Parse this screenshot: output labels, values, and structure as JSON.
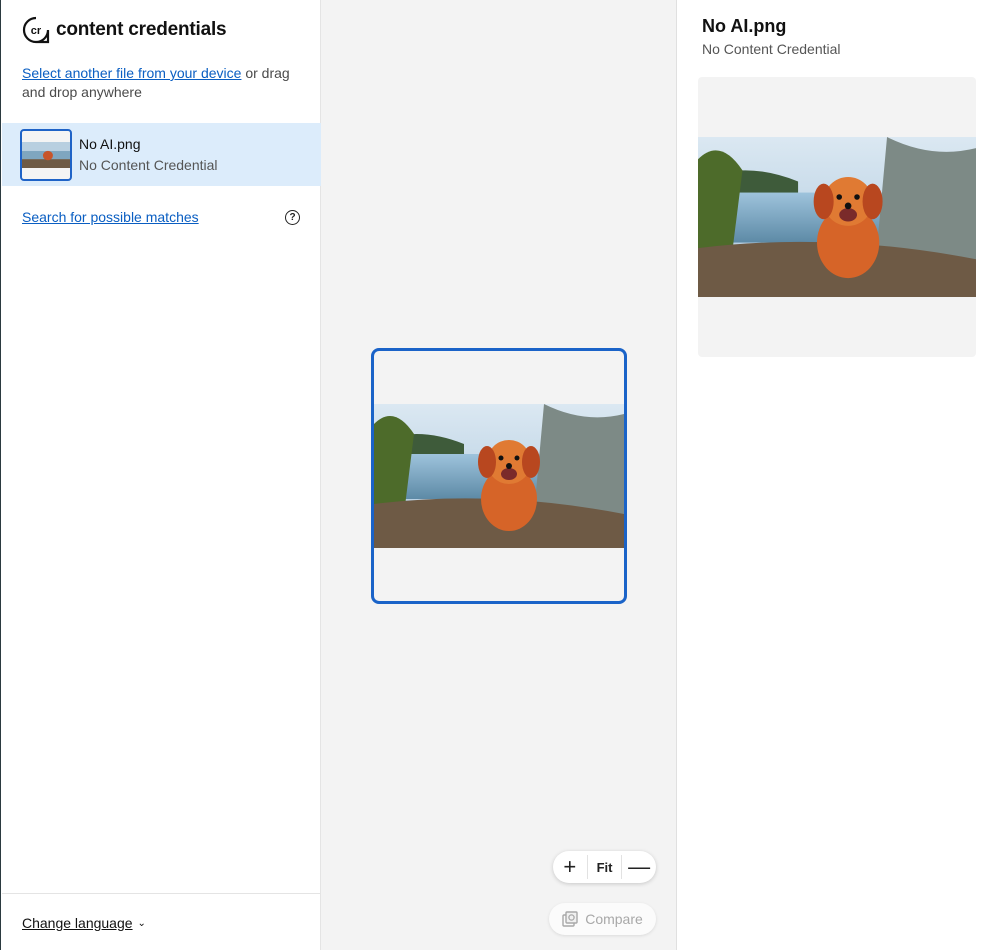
{
  "brand": {
    "name": "content credentials",
    "logo": "cr"
  },
  "intro": {
    "link": "Select another file from your device",
    "rest": " or drag and drop anywhere"
  },
  "file": {
    "name": "No AI.png",
    "status": "No Content Credential"
  },
  "search": {
    "link": "Search for possible matches",
    "help_icon": "question-circle-icon"
  },
  "footer": {
    "language": "Change language"
  },
  "zoom": {
    "in": "+",
    "fit": "Fit",
    "out": "—"
  },
  "compare": {
    "label": "Compare",
    "icon": "compare-icon"
  },
  "details": {
    "title": "No AI.png",
    "subtitle": "No Content Credential"
  },
  "colors": {
    "accent": "#1a63c8",
    "selected_bg": "#dcecfb",
    "link": "#0a5ec2",
    "canvas_bg": "#f3f3f3"
  }
}
